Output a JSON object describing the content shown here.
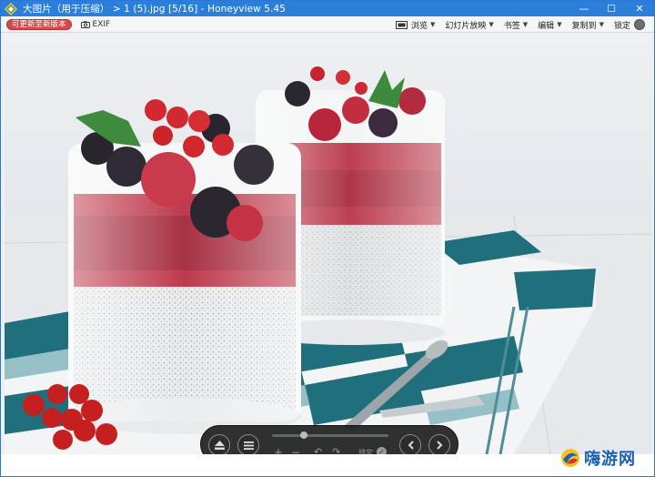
{
  "window": {
    "title": "大图片（用于压缩） > 1 (5).jpg [5/16] - Honeyview 5.45",
    "controls": {
      "minimize": "—",
      "maximize": "☐",
      "close": "✕"
    }
  },
  "toolbar": {
    "update_label": "可更新至新版本",
    "exif_label": "EXIF",
    "menus": [
      {
        "label": "浏览",
        "icon": "browse-icon"
      },
      {
        "label": "幻灯片放映"
      },
      {
        "label": "书签"
      },
      {
        "label": "编辑"
      },
      {
        "label": "复制到"
      }
    ],
    "lock_label": "锁定"
  },
  "viewer": {
    "image_subject": "chia pudding glasses with raspberries, blackberries and redcurrants on a teal checkered cloth"
  },
  "controlbar": {
    "lock_label": "锁定",
    "buttons": [
      "eject",
      "menu",
      "zoom-in",
      "zoom-out",
      "rotate-left",
      "rotate-right",
      "previous",
      "next"
    ],
    "seek_position": 0.27
  },
  "watermark": {
    "text": "嗨游网"
  },
  "colors": {
    "titlebar": "#2b7fd9",
    "update_button": "#d34a4a",
    "watermark": "#1a5fb4"
  }
}
